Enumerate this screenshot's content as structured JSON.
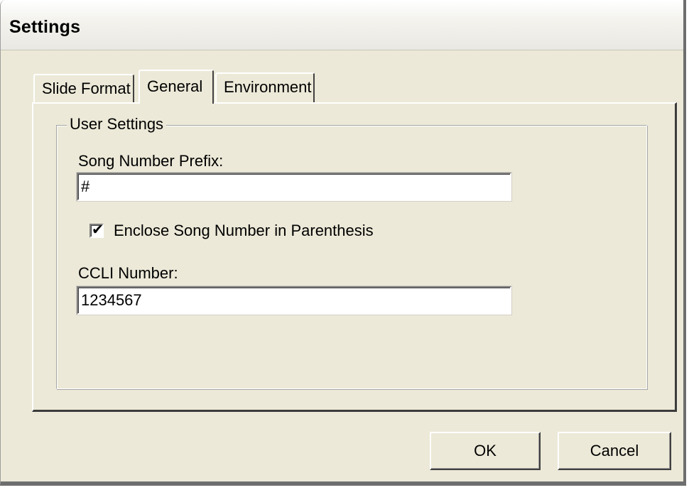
{
  "window": {
    "title": "Settings"
  },
  "tabs": [
    {
      "label": "Slide Format",
      "active": false
    },
    {
      "label": "General",
      "active": true
    },
    {
      "label": "Environment",
      "active": false
    }
  ],
  "group": {
    "legend": "User Settings"
  },
  "fields": {
    "prefix_label": "Song Number Prefix:",
    "prefix_value": "#",
    "enclose_label": "Enclose Song Number in Parenthesis",
    "enclose_checked": true,
    "check_glyph": "✔",
    "ccli_label": "CCLI Number:",
    "ccli_value": "1234567"
  },
  "buttons": {
    "ok_label": "OK",
    "cancel_label": "Cancel"
  },
  "colors": {
    "dialog_bg": "#ece9d8"
  }
}
